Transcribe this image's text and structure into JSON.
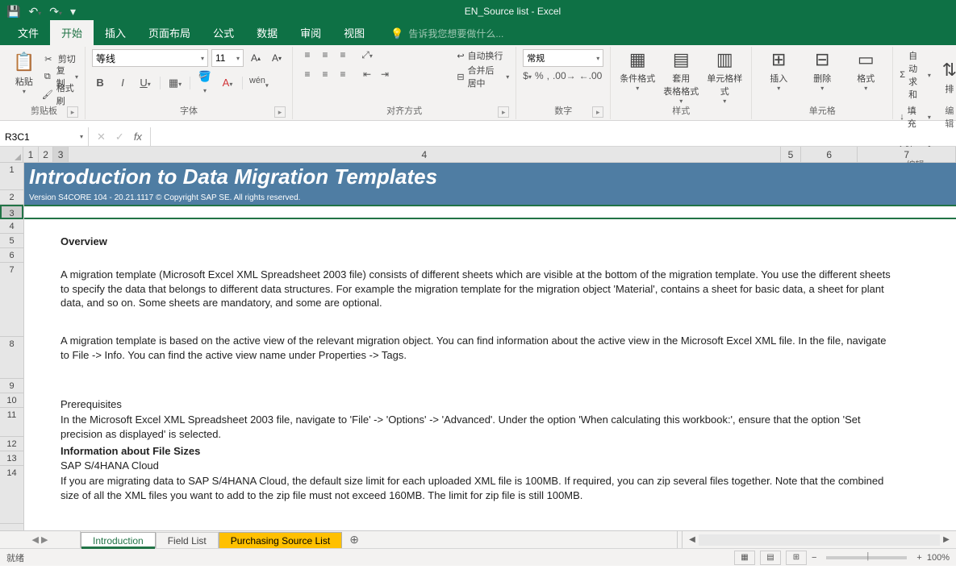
{
  "window": {
    "title": "EN_Source list - Excel"
  },
  "tabs": {
    "file": "文件",
    "home": "开始",
    "insert": "插入",
    "pageLayout": "页面布局",
    "formulas": "公式",
    "data": "数据",
    "review": "审阅",
    "view": "视图",
    "tellMe": "告诉我您想要做什么..."
  },
  "ribbon": {
    "clipboard": {
      "label": "剪贴板",
      "paste": "粘贴",
      "cut": "剪切",
      "copy": "复制",
      "formatPainter": "格式刷"
    },
    "font": {
      "label": "字体",
      "name": "等线",
      "size": "11"
    },
    "alignment": {
      "label": "对齐方式",
      "wrap": "自动换行",
      "merge": "合并后居中"
    },
    "number": {
      "label": "数字",
      "format": "常规"
    },
    "styles": {
      "label": "样式",
      "conditional": "条件格式",
      "tableFormat": "套用\n表格格式",
      "cellStyles": "单元格样式"
    },
    "cells": {
      "label": "单元格",
      "insert": "插入",
      "delete": "删除",
      "format": "格式"
    },
    "editing": {
      "label": "编辑",
      "autosum": "自动求和",
      "fill": "填充",
      "clear": "清除",
      "sortFilter": "排"
    }
  },
  "nameBox": "R3C1",
  "colHeaders": [
    "1",
    "2",
    "3",
    "4",
    "5",
    "6",
    "7"
  ],
  "rowHeaders": [
    "1",
    "2",
    "3",
    "4",
    "5",
    "6",
    "7",
    "8",
    "9",
    "10",
    "11",
    "12",
    "13",
    "14"
  ],
  "doc": {
    "title": "Introduction to Data Migration Templates",
    "version": "Version S4CORE 104  - 20.21.1117 © Copyright SAP SE. All rights reserved.",
    "overview": "Overview",
    "p1": "A migration template (Microsoft Excel XML Spreadsheet 2003 file) consists of different sheets which are visible at the bottom of the migration template. You use the different sheets to specify the data that belongs to different data structures. For example the migration template for the migration object 'Material', contains a sheet for basic data, a sheet for plant data, and so on. Some sheets are mandatory, and some are optional.",
    "p2": "A migration template is based on the active view of the relevant migration object. You can find information about the active view in the Microsoft Excel XML file. In the file, navigate to File -> Info. You can find the active view name under Properties -> Tags.",
    "prereqTitle": "Prerequisites",
    "prereq": "In the Microsoft Excel XML Spreadsheet 2003 file, navigate to 'File' -> 'Options' -> 'Advanced'. Under the option 'When calculating this workbook:', ensure that the option 'Set precision as displayed' is selected.",
    "infoFileSizes": "Information about File Sizes",
    "s4cloud": "SAP S/4HANA Cloud",
    "p3": "If you are migrating data to SAP S/4HANA Cloud, the default size limit for each uploaded XML file is 100MB.  If required, you can zip several files together. Note that the combined size of all the XML files you want to add to the zip file must not exceed 160MB.  The limit for zip file is still 100MB."
  },
  "sheets": {
    "introduction": "Introduction",
    "fieldList": "Field List",
    "purchasing": "Purchasing Source List"
  },
  "statusbar": {
    "ready": "就绪",
    "zoom": "100%"
  }
}
